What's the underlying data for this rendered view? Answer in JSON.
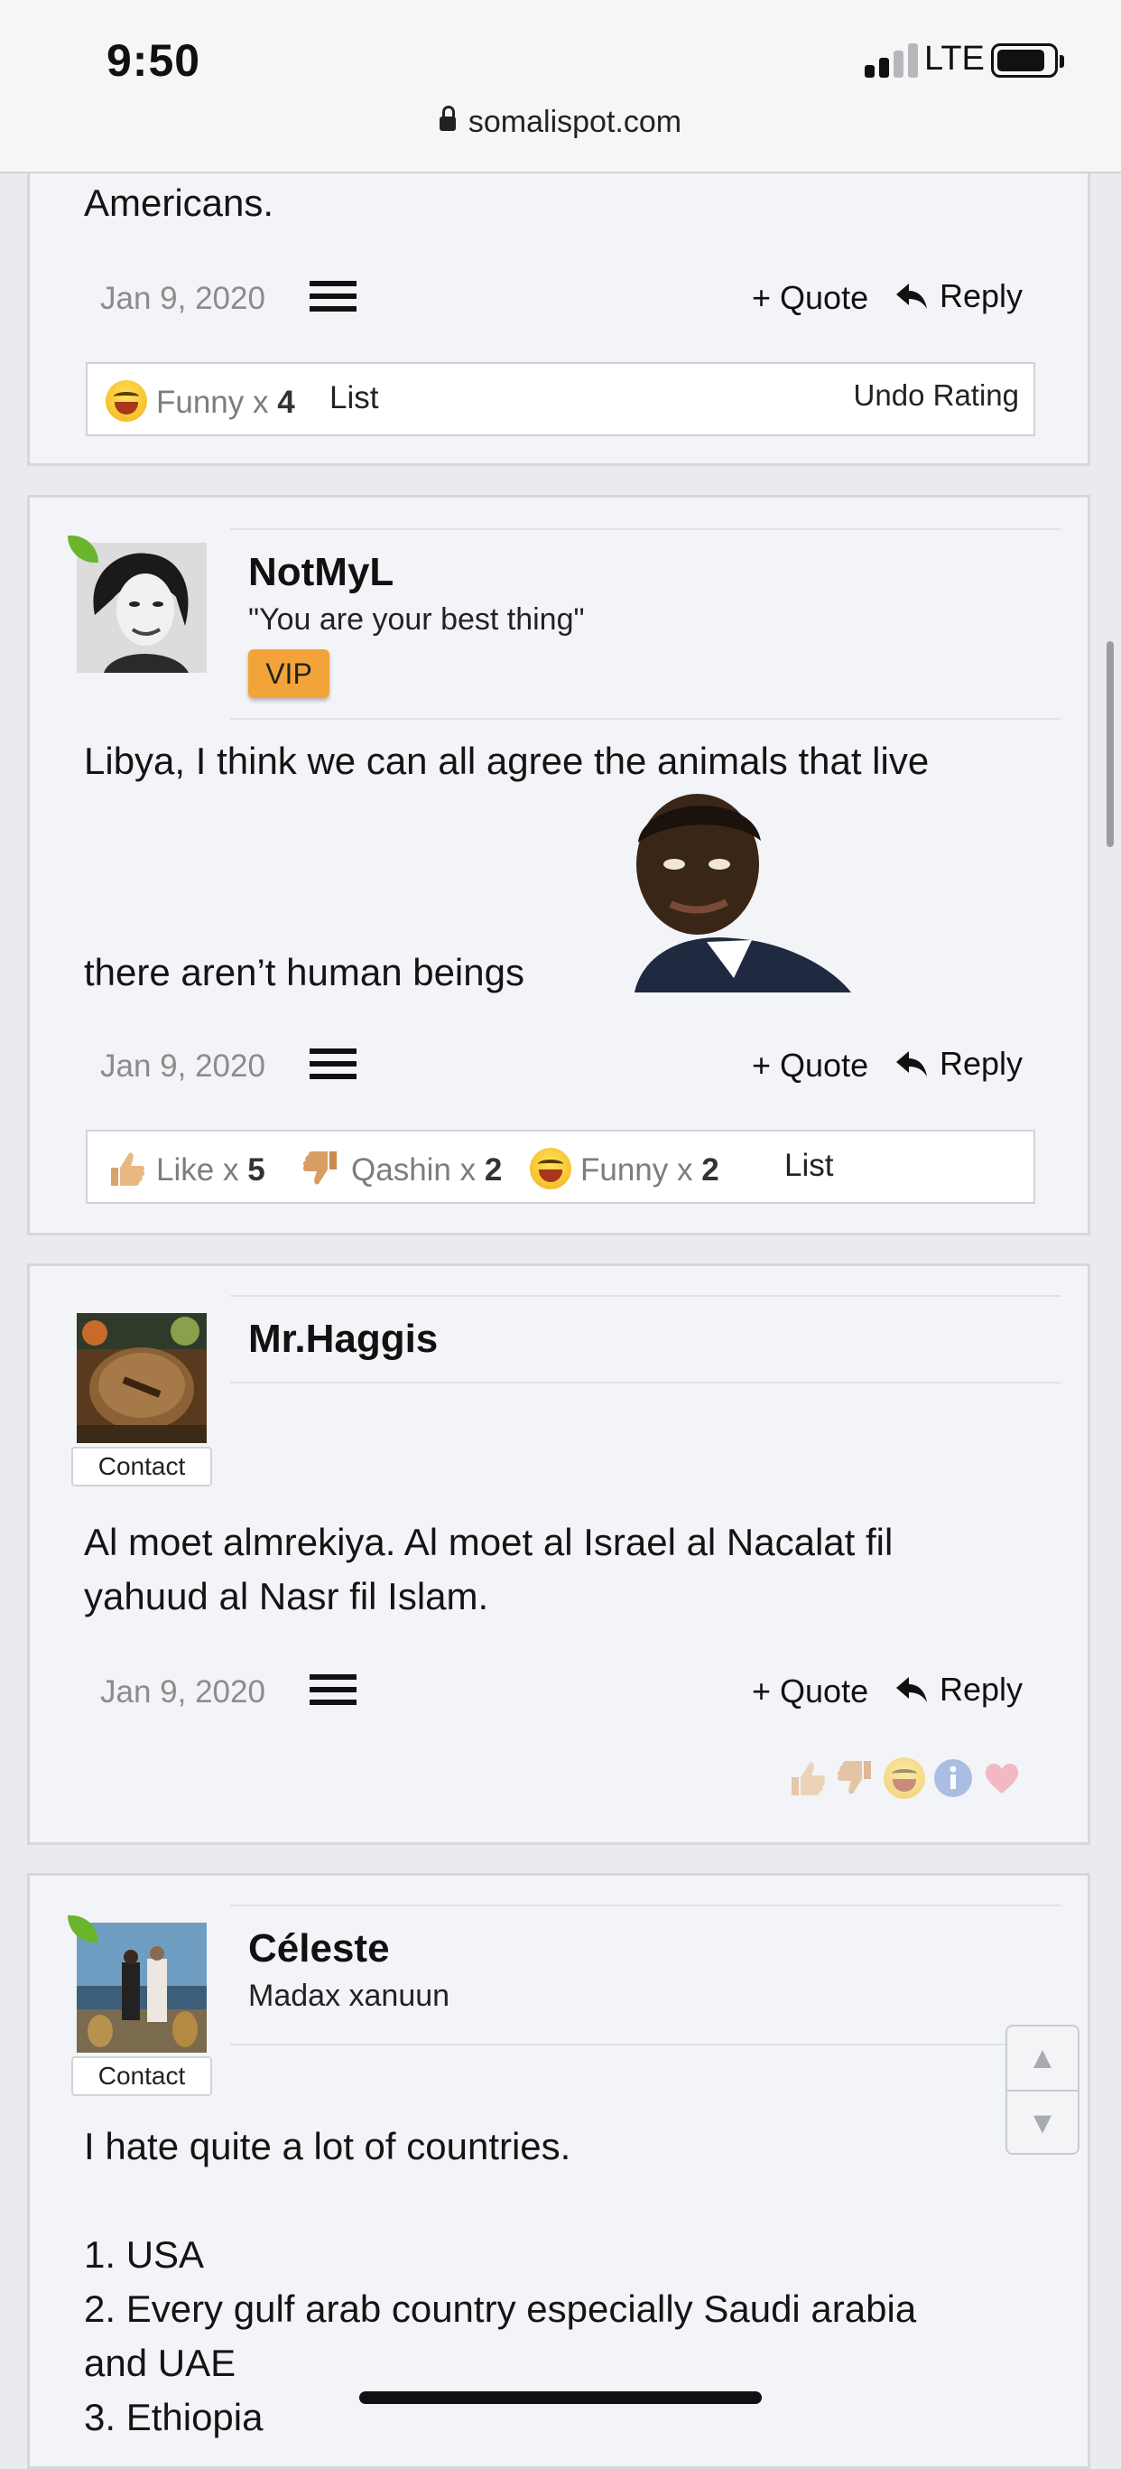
{
  "status_bar": {
    "time": "9:50",
    "network": "LTE"
  },
  "url_bar": {
    "domain": "somalispot.com"
  },
  "posts": [
    {
      "text": "Americans.",
      "date": "Jan 9, 2020",
      "quote_label": "+ Quote",
      "reply_label": "Reply",
      "reactions": [
        {
          "name": "Funny",
          "sep": "x",
          "count": "4"
        }
      ],
      "list_label": "List",
      "undo_label": "Undo Rating"
    },
    {
      "author": "NotMyL",
      "user_title": "\"You are your best thing\"",
      "badge": "VIP",
      "text_line1": "Libya, I think we can all agree the animals that live",
      "text_line2": "there aren’t human beings",
      "date": "Jan 9, 2020",
      "quote_label": "+ Quote",
      "reply_label": "Reply",
      "reactions": [
        {
          "name": "Like",
          "sep": "x",
          "count": "5"
        },
        {
          "name": "Qashin",
          "sep": "x",
          "count": "2"
        },
        {
          "name": "Funny",
          "sep": "x",
          "count": "2"
        }
      ],
      "list_label": "List"
    },
    {
      "author": "Mr.Haggis",
      "contact_label": "Contact",
      "text": "Al moet almrekiya. Al moet al Israel al Nacalat fil\nyahuud al Nasr fil Islam.",
      "date": "Jan 9, 2020",
      "quote_label": "+ Quote",
      "reply_label": "Reply"
    },
    {
      "author": "Céleste",
      "user_title": "Madax xanuun",
      "contact_label": "Contact",
      "text": "I hate quite a lot of countries.\n\n1. USA\n2. Every gulf arab country especially Saudi arabia\nand UAE\n3. Ethiopia"
    }
  ],
  "colors": {
    "vip_badge": "#f2a43a",
    "leaf": "#6ab42e",
    "page_bg": "#e9ebee"
  }
}
